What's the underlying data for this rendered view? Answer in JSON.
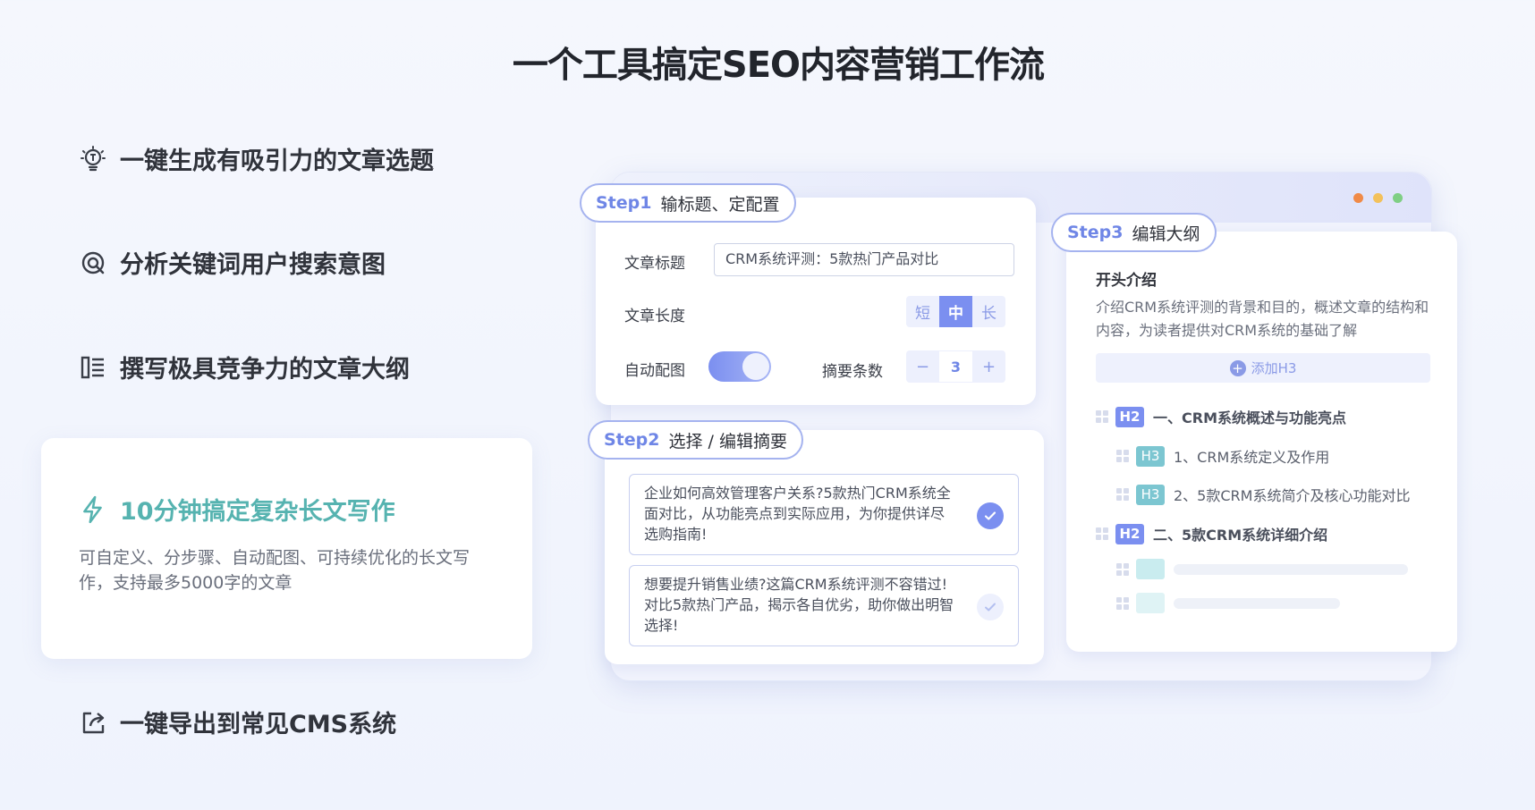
{
  "page": {
    "title": "一个工具搞定SEO内容营销工作流"
  },
  "features": [
    {
      "icon": "lightbulb-icon",
      "label": "一键生成有吸引力的文章选题"
    },
    {
      "icon": "search-target-icon",
      "label": "分析关键词用户搜索意图"
    },
    {
      "icon": "outline-icon",
      "label": "撰写极具竞争力的文章大纲"
    },
    {
      "icon": "export-icon",
      "label": "一键导出到常见CMS系统"
    }
  ],
  "highlight": {
    "icon": "lightning-icon",
    "title": "10分钟搞定复杂长文写作",
    "desc": "可自定义、分步骤、自动配图、可持续优化的长文写作，支持最多5000字的文章"
  },
  "window": {
    "dots": [
      "#f08a47",
      "#f3c15b",
      "#7fcf84"
    ]
  },
  "step1": {
    "num": "Step1",
    "label": "输标题、定配置",
    "title_label": "文章标题",
    "title_value": "CRM系统评测：5款热门产品对比",
    "length_label": "文章长度",
    "length_options": [
      "短",
      "中",
      "长"
    ],
    "length_selected": "中",
    "auto_image_label": "自动配图",
    "auto_image_on": true,
    "summary_count_label": "摘要条数",
    "summary_minus": "−",
    "summary_count": "3",
    "summary_plus": "+"
  },
  "step2": {
    "num": "Step2",
    "label": "选择 / 编辑摘要",
    "summaries": [
      {
        "text": "企业如何高效管理客户关系?5款热门CRM系统全面对比，从功能亮点到实际应用，为你提供详尽选购指南!",
        "selected": true
      },
      {
        "text": "想要提升销售业绩?这篇CRM系统评测不容错过!对比5款热门产品，揭示各自优劣，助你做出明智选择!",
        "selected": false
      }
    ]
  },
  "step3": {
    "num": "Step3",
    "label": "编辑大纲",
    "intro_title": "开头介绍",
    "intro_text": "介绍CRM系统评测的背景和目的，概述文章的结构和内容，为读者提供对CRM系统的基础了解",
    "add_h3": "添加H3",
    "outline": [
      {
        "tag": "H2",
        "text": "一、CRM系统概述与功能亮点"
      },
      {
        "tag": "H3",
        "text": "1、CRM系统定义及作用"
      },
      {
        "tag": "H3",
        "text": "2、5款CRM系统简介及核心功能对比"
      },
      {
        "tag": "H2",
        "text": "二、5款CRM系统详细介绍"
      }
    ]
  }
}
